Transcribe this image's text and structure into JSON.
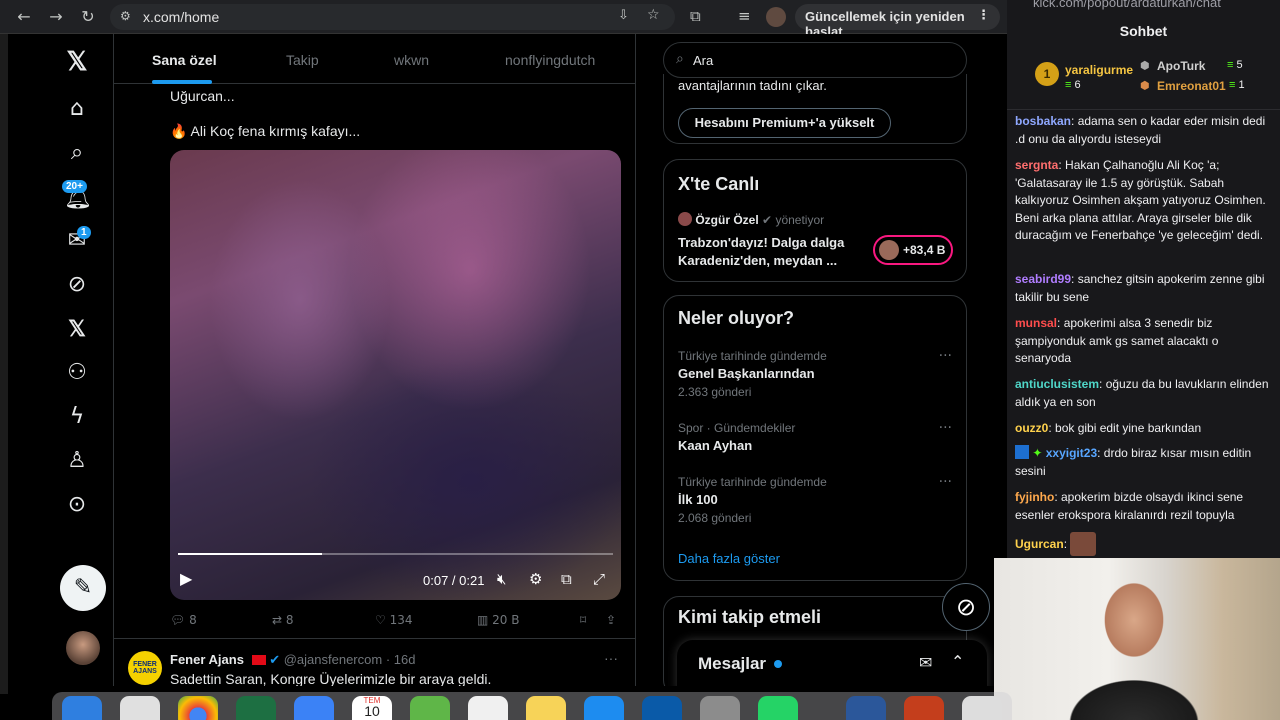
{
  "browser": {
    "url": "x.com/home",
    "update_button": "Güncellemek için yeniden başlat"
  },
  "sidebar": {
    "notifications_badge": "20+",
    "messages_badge": "1"
  },
  "timeline": {
    "tabs": [
      "Sana özel",
      "Takip",
      "wkwn",
      "nonflyingdutch"
    ],
    "tweet": {
      "text_line1": "Uğurcan...",
      "text_line2": "🔥 Ali Koç fena kırmış kafayı...",
      "video_time": "0:07 / 0:21",
      "video_progress": 0.33,
      "replies": "8",
      "reposts": "8",
      "likes": "134",
      "views": "20 B"
    },
    "next_tweet": {
      "avatar_text": "FENER AJANS",
      "name": "Fener Ajans",
      "handle": "@ajansfenercom",
      "time": "· 16d",
      "text": "Sadettin Saran, Kongre Üyelerimizle bir araya geldi."
    }
  },
  "right": {
    "search_placeholder": "Ara",
    "premium": {
      "text": "avantajlarının tadını çıkar.",
      "button": "Hesabını Premium+'a yükselt"
    },
    "live": {
      "title": "X'te Canlı",
      "host": "Özgür Özel",
      "host_role": "yönetiyor",
      "topic_line1": "Trabzon'dayız! Dalga dalga",
      "topic_line2": "Karadeniz'den, meydan ...",
      "listeners": "+83,4 B"
    },
    "trends": {
      "title": "Neler oluyor?",
      "items": [
        {
          "context": "Türkiye tarihinde gündemde",
          "name": "Genel Başkanlarından",
          "count": "2.363 gönderi"
        },
        {
          "context": "Spor · Gündemdekiler",
          "name": "Kaan Ayhan",
          "count": ""
        },
        {
          "context": "Türkiye tarihinde gündemde",
          "name": "İlk 100",
          "count": "2.068 gönderi"
        }
      ],
      "show_more": "Daha fazla göster"
    },
    "follow": {
      "title": "Kimi takip etmeli"
    },
    "messages": {
      "title": "Mesajlar"
    }
  },
  "chat": {
    "url": "kick.com/popout/ardaturkan/chat",
    "title": "Sohbet",
    "leaderboard": {
      "first": {
        "name": "yaraligurme",
        "count": "6"
      },
      "second": {
        "name": "ApoTurk",
        "count": "5"
      },
      "third": {
        "name": "Emreonat01",
        "count": "1"
      }
    },
    "messages": [
      {
        "user": "bosbakan",
        "color": "#8fa8ff",
        "text": "adama sen o kadar eder misin dedi .d onu da alıyordu isteseydi"
      },
      {
        "user": "sergnta",
        "color": "#ff6e6e",
        "text": "Hakan Çalhanoğlu Ali Koç 'a; 'Galatasaray ile 1.5 ay görüştük. Sabah kalkıyoruz Osimhen akşam yatıyoruz Osimhen. Beni arka plana attılar. Araya girseler bile dik duracağım ve Fenerbahçe 'ye geleceğim' dedi."
      },
      {
        "user": "seabird99",
        "color": "#b07dff",
        "text": "sanchez gitsin apokerim zenne gibi takilir bu sene"
      },
      {
        "user": "munsal",
        "color": "#ff4d4d",
        "text": "apokerimi alsa 3 senedir biz şampiyonduk amk gs samet alacaktı o senaryoda"
      },
      {
        "user": "antiuclusistem",
        "color": "#4fd6c8",
        "text": "oğuzu da bu lavukların elinden aldık ya en son"
      },
      {
        "user": "ouzz0",
        "color": "#ffd24d",
        "text": "bok gibi edit yine barkından"
      },
      {
        "user": "xxyigit23",
        "color": "#58a6ff",
        "text": "drdo biraz kısar mısın editin sesini"
      },
      {
        "user": "fyjinho",
        "color": "#ffa94d",
        "text": "apokerim bizde olsaydı ikinci sene esenler erokspora kiralanırdı rezil topuyla"
      },
      {
        "user": "Ugurcan",
        "color": "#ffd24d",
        "text": ""
      }
    ]
  },
  "dock": {
    "calendar_month": "TEM",
    "calendar_day": "10"
  }
}
